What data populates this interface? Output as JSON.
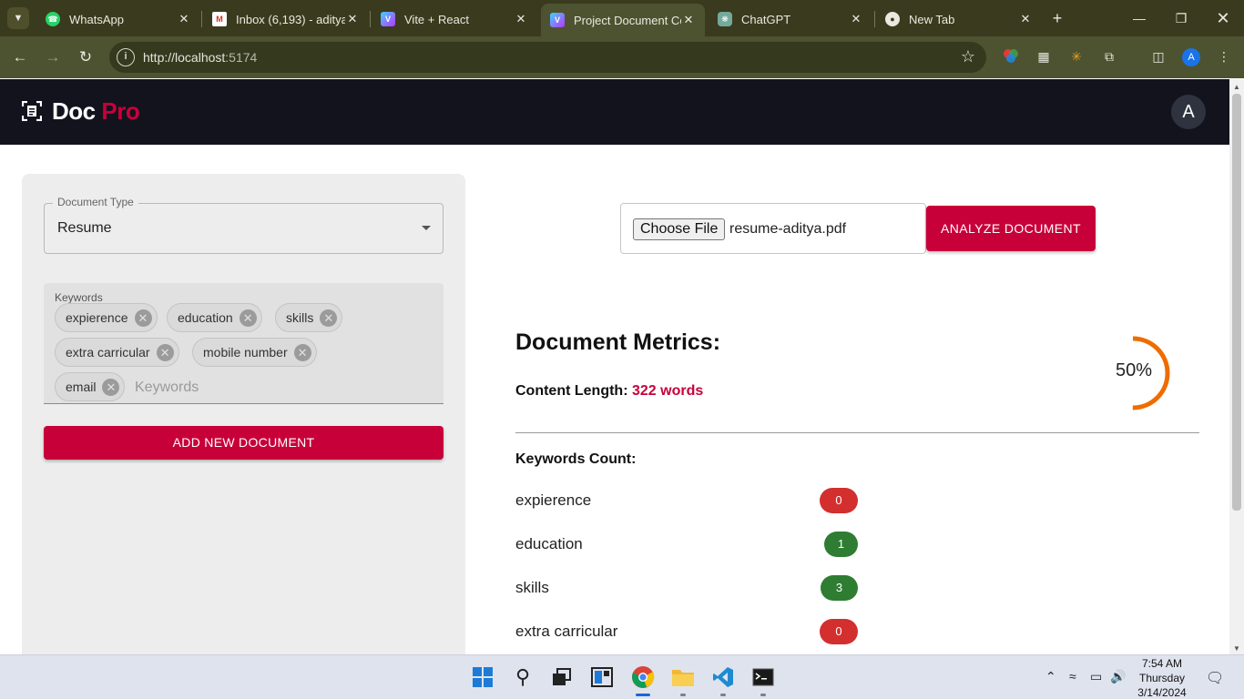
{
  "browser": {
    "tabs": [
      {
        "label": "WhatsApp"
      },
      {
        "label": "Inbox (6,193) - aditya"
      },
      {
        "label": "Vite + React"
      },
      {
        "label": "Project Document Co"
      },
      {
        "label": "ChatGPT"
      },
      {
        "label": "New Tab"
      }
    ],
    "active_tab_index": 3,
    "url_host": "http://localhost",
    "url_port": ":5174",
    "profile_initial": "A"
  },
  "app": {
    "logo_word": "Doc",
    "logo_accent": "Pro",
    "avatar_initial": "A",
    "colors": {
      "brand": "#c8003a",
      "header": "#12131d",
      "badge_zero": "#d32f2f",
      "badge_positive": "#2e7d32",
      "gauge": "#ef6c00"
    }
  },
  "sidebar": {
    "document_type_label": "Document Type",
    "document_type_value": "Resume",
    "keywords_label": "Keywords",
    "keywords_placeholder": "Keywords",
    "keywords": [
      "expierence",
      "education",
      "skills",
      "extra carricular",
      "mobile number",
      "email"
    ],
    "add_button_label": "ADD NEW DOCUMENT"
  },
  "upload": {
    "choose_file_label": "Choose File",
    "file_name": "resume-aditya.pdf",
    "analyze_button_label": "ANALYZE DOCUMENT"
  },
  "metrics": {
    "title": "Document Metrics:",
    "content_length_label": "Content Length:",
    "content_length_value": "322 words",
    "score_label": "50%",
    "score_fraction": 0.5,
    "keywords_count_title": "Keywords Count:",
    "keyword_counts": [
      {
        "keyword": "expierence",
        "count": "0"
      },
      {
        "keyword": "education",
        "count": "1"
      },
      {
        "keyword": "skills",
        "count": "3"
      },
      {
        "keyword": "extra carricular",
        "count": "0"
      }
    ]
  },
  "taskbar": {
    "time": "7:54 AM",
    "day": "Thursday",
    "date": "3/14/2024"
  }
}
